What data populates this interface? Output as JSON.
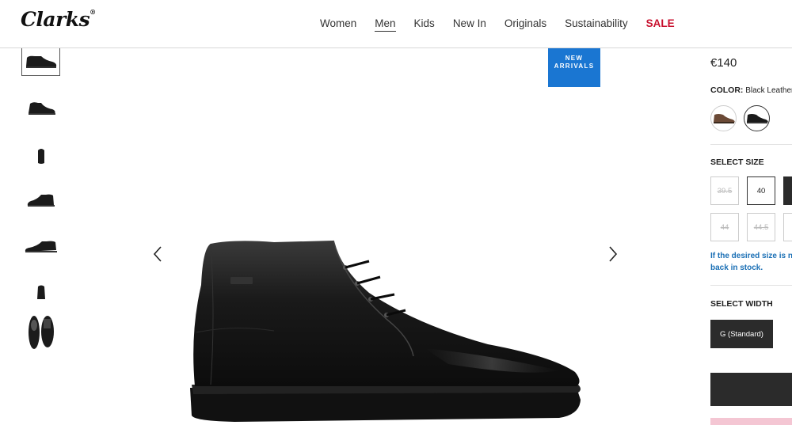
{
  "brand": {
    "logo_text": "Clarks",
    "logo_mark": "®"
  },
  "nav": {
    "items": [
      {
        "label": "Women"
      },
      {
        "label": "Men"
      },
      {
        "label": "Kids"
      },
      {
        "label": "New In"
      },
      {
        "label": "Originals"
      },
      {
        "label": "Sustainability"
      },
      {
        "label": "SALE"
      }
    ],
    "active": "Men",
    "sale_color": "#c8102e"
  },
  "gallery": {
    "thumbnails": [
      "side-view",
      "angle-view",
      "front-view",
      "side-view-2",
      "profile-view",
      "heel-view",
      "sole-view"
    ],
    "selected_index": 0,
    "badge": {
      "line1": "NEW",
      "line2": "ARRIVALS",
      "color": "#1a76d2"
    },
    "prev_icon": "chevron-left-icon",
    "next_icon": "chevron-right-icon"
  },
  "product": {
    "price": "€140",
    "color_label": "COLOR:",
    "color_value": "Black Leather",
    "swatches": [
      {
        "name": "Brown Leather"
      },
      {
        "name": "Black Leather"
      }
    ],
    "size_title": "SELECT SIZE",
    "sizes": [
      {
        "label": "39.5",
        "available": false
      },
      {
        "label": "40",
        "available": true
      },
      {
        "label": "",
        "available": true
      },
      {
        "label": "44",
        "available": false
      },
      {
        "label": "44.5",
        "available": false
      },
      {
        "label": "",
        "available": false
      }
    ],
    "stock_note_line1": "If the desired size is no",
    "stock_note_line2": "back in stock.",
    "width_title": "SELECT WIDTH",
    "width_option": "G (Standard)"
  }
}
